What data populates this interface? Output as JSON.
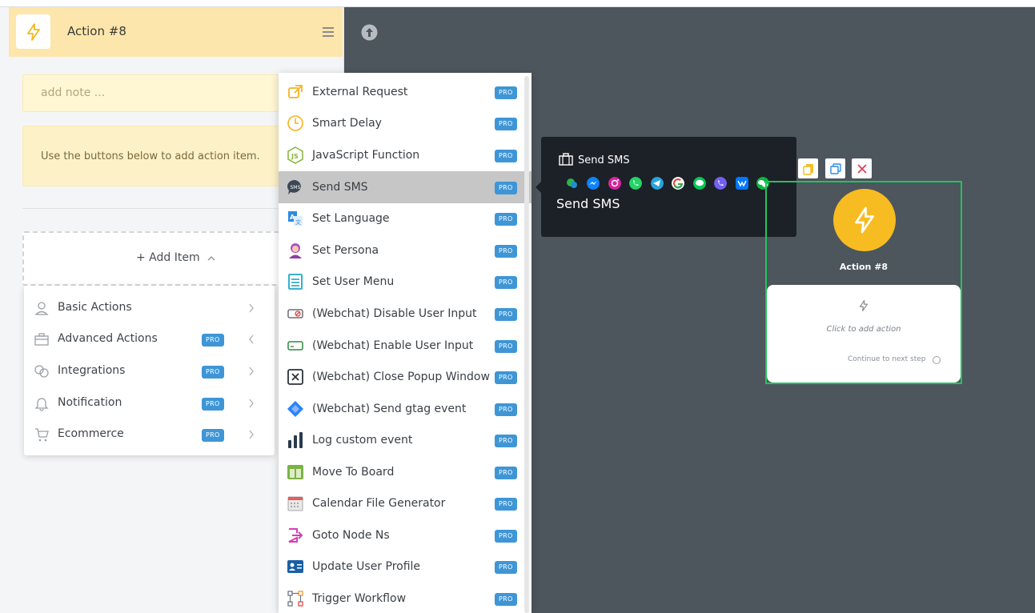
{
  "panel": {
    "title": "Action #8",
    "note_placeholder": "add note ...",
    "info_text": "Use the buttons below to add action item.",
    "add_item_label": "+ Add Item"
  },
  "categories": [
    {
      "label": "Basic Actions",
      "icon": "person-icon",
      "pro": false,
      "expanded": false
    },
    {
      "label": "Advanced Actions",
      "icon": "toolbox-icon",
      "pro": true,
      "expanded": true
    },
    {
      "label": "Integrations",
      "icon": "chat-bubbles-icon",
      "pro": true,
      "expanded": false
    },
    {
      "label": "Notification",
      "icon": "bell-icon",
      "pro": true,
      "expanded": false
    },
    {
      "label": "Ecommerce",
      "icon": "cart-icon",
      "pro": true,
      "expanded": false
    }
  ],
  "pro_label": "PRO",
  "actions": [
    {
      "label": "External Request",
      "icon": "external-link-icon"
    },
    {
      "label": "Smart Delay",
      "icon": "clock-icon"
    },
    {
      "label": "JavaScript Function",
      "icon": "javascript-icon"
    },
    {
      "label": "Send SMS",
      "icon": "sms-icon",
      "active": true
    },
    {
      "label": "Set Language",
      "icon": "translate-icon"
    },
    {
      "label": "Set Persona",
      "icon": "persona-icon"
    },
    {
      "label": "Set User Menu",
      "icon": "menu-list-icon"
    },
    {
      "label": "(Webchat) Disable User Input",
      "icon": "disable-input-icon"
    },
    {
      "label": "(Webchat) Enable User Input",
      "icon": "enable-input-icon"
    },
    {
      "label": "(Webchat) Close Popup Window",
      "icon": "close-window-icon"
    },
    {
      "label": "(Webchat) Send gtag event",
      "icon": "gtag-icon"
    },
    {
      "label": "Log custom event",
      "icon": "bar-chart-icon"
    },
    {
      "label": "Move To Board",
      "icon": "board-icon"
    },
    {
      "label": "Calendar File Generator",
      "icon": "calendar-icon"
    },
    {
      "label": "Goto Node Ns",
      "icon": "goto-icon"
    },
    {
      "label": "Update User Profile",
      "icon": "profile-card-icon"
    },
    {
      "label": "Trigger Workflow",
      "icon": "workflow-icon"
    }
  ],
  "tooltip": {
    "header": "Send SMS",
    "title": "Send SMS",
    "channels": [
      "sms-chat",
      "messenger",
      "instagram",
      "whatsapp",
      "telegram",
      "google",
      "line",
      "viber",
      "vk",
      "wechat"
    ]
  },
  "node": {
    "title": "Action #8",
    "card_text": "Click to add action",
    "continue_text": "Continue to next step"
  },
  "colors": {
    "accent_yellow": "#f7bc21",
    "node_border": "#22c35e",
    "pro_badge": "#3e96d6",
    "canvas_bg": "#4d555d"
  }
}
